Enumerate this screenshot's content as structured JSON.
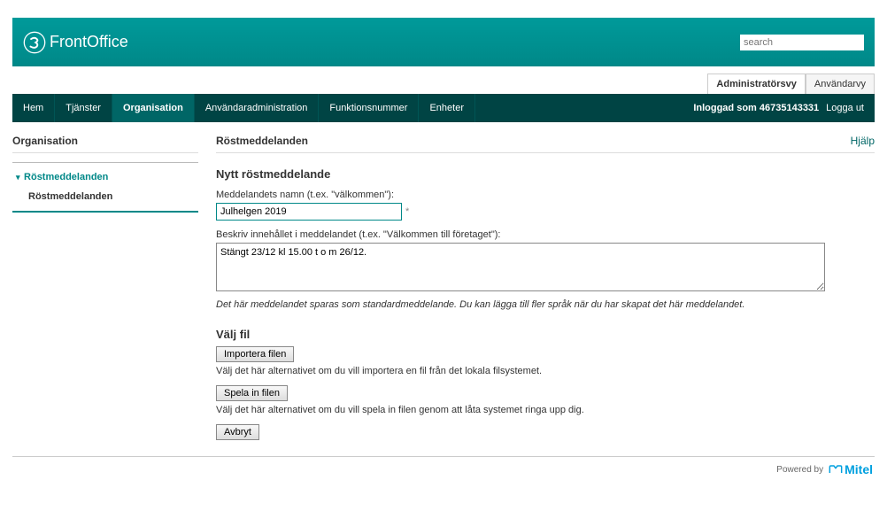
{
  "brand": {
    "product_name": "FrontOffice"
  },
  "search": {
    "placeholder": "search"
  },
  "view_tabs": {
    "admin": "Administratörsvy",
    "user": "Användarvy"
  },
  "nav": {
    "items": [
      "Hem",
      "Tjänster",
      "Organisation",
      "Användaradministration",
      "Funktionsnummer",
      "Enheter"
    ],
    "logged_in_prefix": "Inloggad som",
    "logged_in_user": "46735143331",
    "logout": "Logga ut"
  },
  "sidebar": {
    "title": "Organisation",
    "group_title": "Röstmeddelanden",
    "subitem": "Röstmeddelanden"
  },
  "main": {
    "page_title": "Röstmeddelanden",
    "help": "Hjälp",
    "form_heading": "Nytt röstmeddelande",
    "name_label": "Meddelandets namn (t.ex. \"välkommen\"):",
    "name_value": "Julhelgen 2019",
    "asterisk": "*",
    "desc_label": "Beskriv innehållet i meddelandet (t.ex. \"Välkommen till företaget\"):",
    "desc_value": "Stängt 23/12 kl 15.00 t o m 26/12.",
    "hint": "Det här meddelandet sparas som standardmeddelande. Du kan lägga till fler språk när du har skapat det här meddelandet.",
    "choose_file_heading": "Välj fil",
    "import_btn": "Importera filen",
    "import_desc": "Välj det här alternativet om du vill importera en fil från det lokala filsystemet.",
    "record_btn": "Spela in filen",
    "record_desc": "Välj det här alternativet om du vill spela in filen genom att låta systemet ringa upp dig.",
    "cancel_btn": "Avbryt"
  },
  "footer": {
    "powered_by": "Powered by",
    "vendor": "Mitel"
  }
}
